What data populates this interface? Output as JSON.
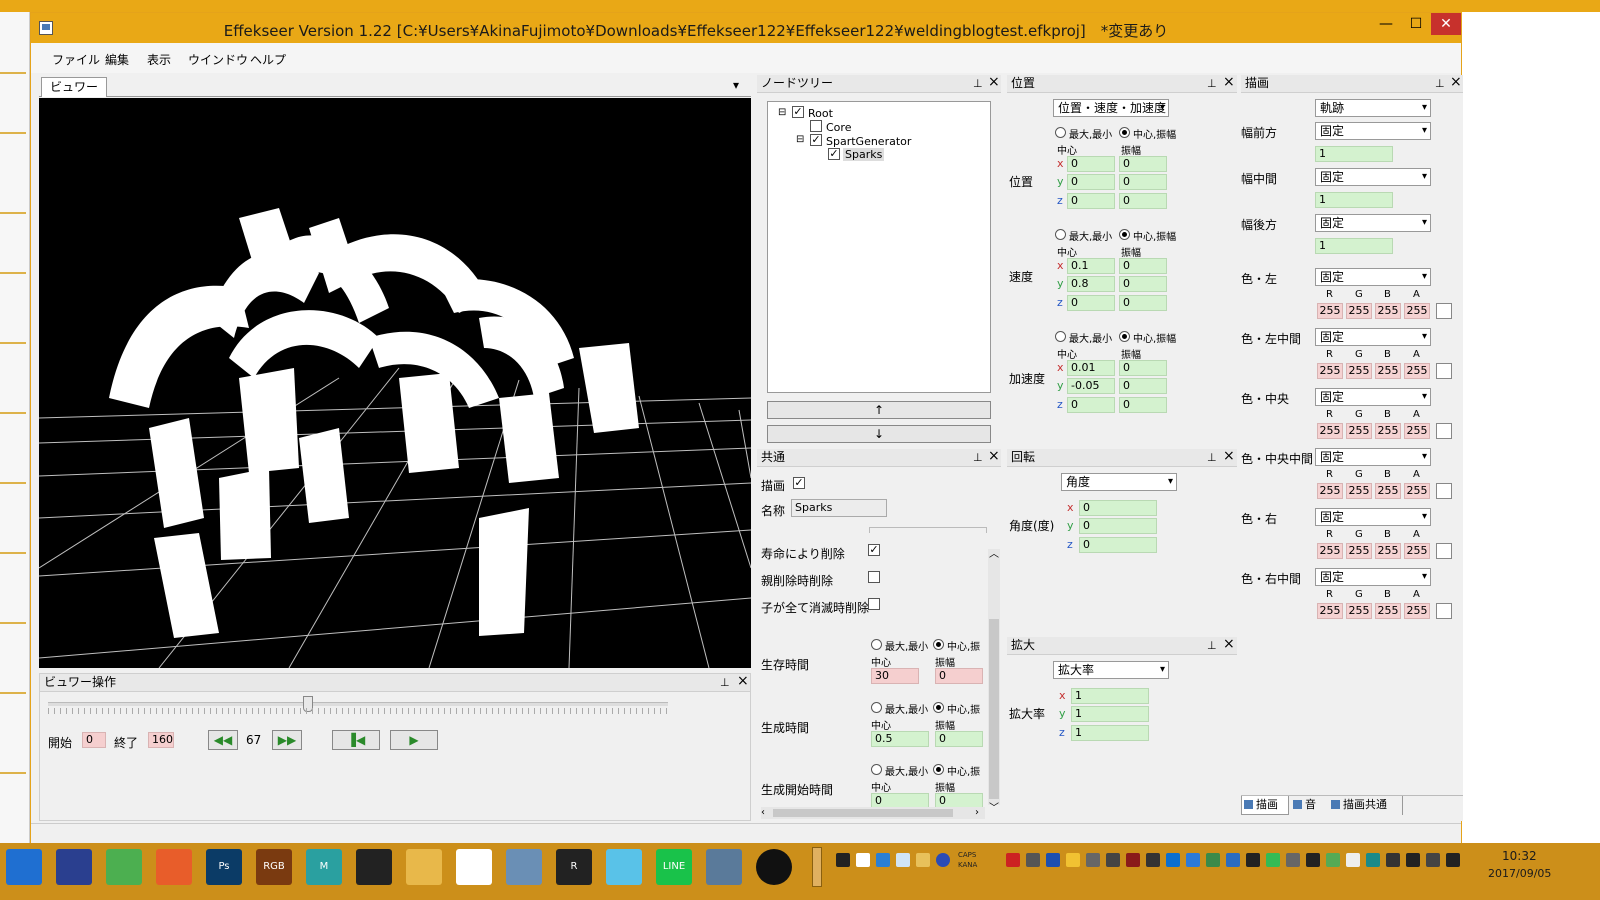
{
  "window": {
    "title": "Effekseer Version 1.22 [C:¥Users¥AkinaFujimoto¥Downloads¥Effekseer122¥Effekseer122¥weldingblogtest.efkproj]　*変更あり",
    "min_glyph": "—",
    "max_glyph": "☐",
    "close_glyph": "✕"
  },
  "menu": [
    "ファイル",
    "編集",
    "表示",
    "ウインドウ",
    "ヘルプ"
  ],
  "viewer": {
    "tab": "ビュワー",
    "dropdown_glyph": "▾"
  },
  "viewer_control": {
    "title": "ビュワー操作",
    "start_label": "開始",
    "start_value": "0",
    "end_label": "終了",
    "end_value": "160",
    "current_frame": "67",
    "slider_position": 0.42
  },
  "node_tree": {
    "title": "ノードツリー",
    "nodes": [
      "Root",
      "Core",
      "SpartGenerator",
      "Sparks"
    ],
    "up_button": "↑",
    "down_button": "↓"
  },
  "common": {
    "title": "共通",
    "draw_label": "描画",
    "name_label": "名称",
    "name_value": "Sparks",
    "delete_on_life": "寿命により削除",
    "delete_on_parent": "親削除時削除",
    "delete_on_children": "子が全て消滅時削除",
    "lifetime_label": "生存時間",
    "gen_time_label": "生成時間",
    "gen_start_label": "生成開始時間",
    "radio_minmax": "最大,最小",
    "radio_center": "中心,振",
    "center_label": "中心",
    "amp_label": "振幅",
    "life_center": "30",
    "life_amp": "0",
    "gen_center": "0.5",
    "gen_amp": "0",
    "start_center": "0",
    "start_amp": "0"
  },
  "position": {
    "title": "位置",
    "mode": "位置・速度・加速度",
    "radio_minmax": "最大,最小",
    "radio_center": "中心,振幅",
    "center_label": "中心",
    "amp_label": "振幅",
    "pos_label": "位置",
    "vel_label": "速度",
    "acc_label": "加速度",
    "axes": [
      "x",
      "y",
      "z"
    ],
    "pos_center": [
      "0",
      "0",
      "0"
    ],
    "pos_amp": [
      "0",
      "0",
      "0"
    ],
    "vel_center": [
      "0.1",
      "0.8",
      "0"
    ],
    "vel_amp": [
      "0",
      "0",
      "0"
    ],
    "acc_center": [
      "0.01",
      "-0.05",
      "0"
    ],
    "acc_amp": [
      "0",
      "0",
      "0"
    ]
  },
  "rotation": {
    "title": "回転",
    "mode": "角度",
    "label": "角度(度)",
    "values": [
      "0",
      "0",
      "0"
    ]
  },
  "scale": {
    "title": "拡大",
    "mode": "拡大率",
    "label": "拡大率",
    "values": [
      "1",
      "1",
      "1"
    ]
  },
  "draw": {
    "title": "描画",
    "type": "軌跡",
    "width_front_label": "幅前方",
    "width_mid_label": "幅中間",
    "width_back_label": "幅後方",
    "fixed": "固定",
    "width_values": [
      "1",
      "1",
      "1"
    ],
    "color_labels": [
      "色・左",
      "色・左中間",
      "色・中央",
      "色・中央中間",
      "色・右",
      "色・右中間"
    ],
    "rgba_headers": [
      "R",
      "G",
      "B",
      "A"
    ],
    "rgba_value": "255"
  },
  "bottom_tabs": [
    "描画",
    "音",
    "描画共通"
  ],
  "taskbar": {
    "clock_time": "10:32",
    "clock_date": "2017/09/05",
    "ime_caps": "CAPS",
    "ime_kana": "KANA",
    "apps": [
      "windows-start",
      "visual-studio",
      "app-green",
      "color-picker",
      "photoshop",
      "rgb-checker",
      "maya",
      "film",
      "explorer",
      "chrome",
      "notepad",
      "r-app",
      "app-circle",
      "line",
      "app-window",
      "record"
    ],
    "app_labels": {
      "photoshop": "Ps",
      "maya": "M",
      "line": "LINE",
      "rgb-checker": "RGB",
      "r-app": "R"
    }
  },
  "colors": {
    "accent_orange": "#e9a816",
    "taskbar": "#cc8f1a",
    "field_green": "#d4f2cf",
    "field_pink": "#f5cfcf"
  }
}
